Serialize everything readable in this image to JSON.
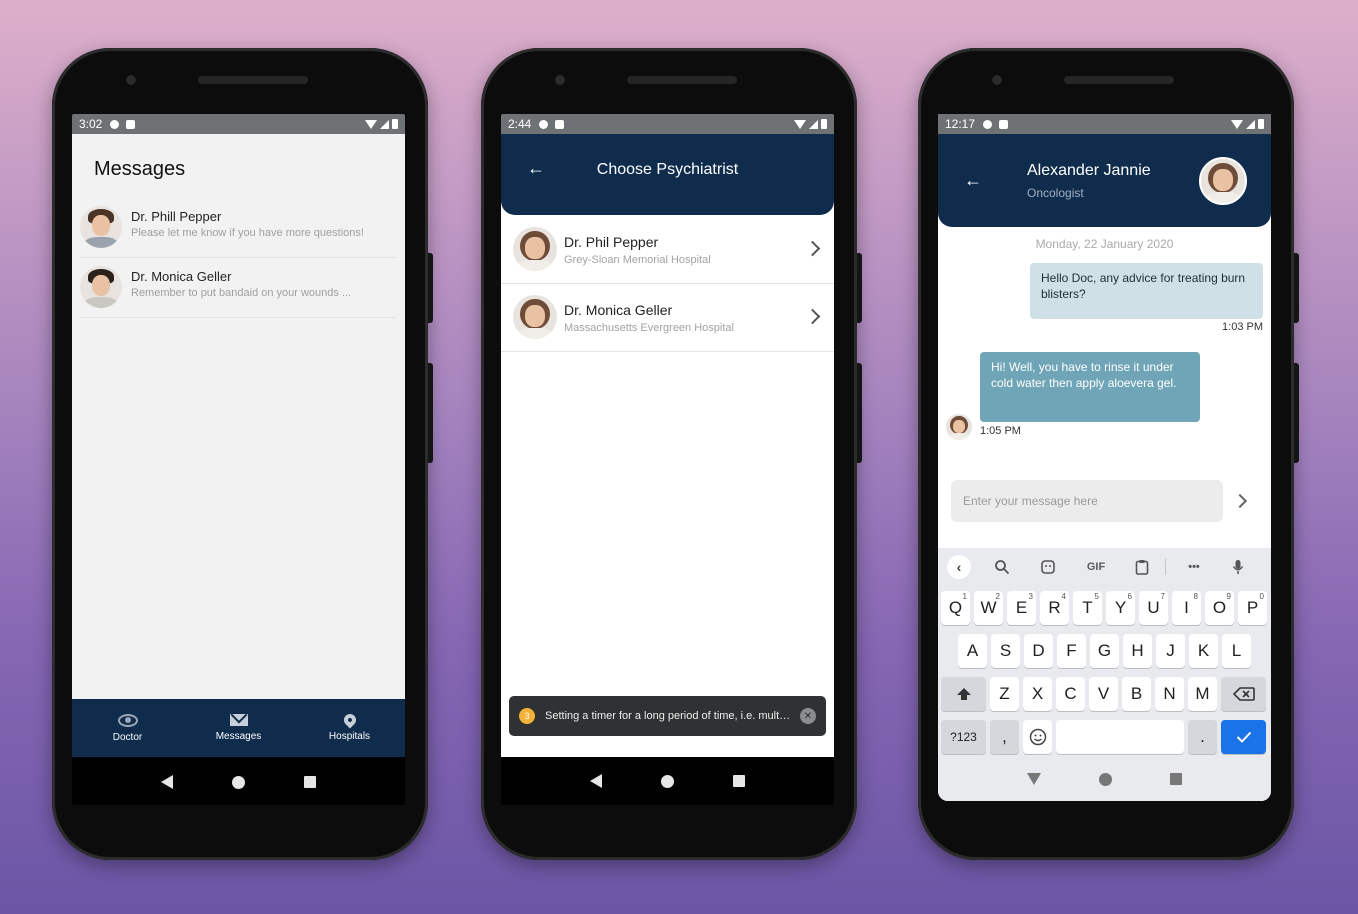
{
  "phone1": {
    "status": {
      "time": "3:02"
    },
    "title": "Messages",
    "messages": [
      {
        "name": "Dr. Phill Pepper",
        "preview": "Please let me know if you have more questions!"
      },
      {
        "name": "Dr. Monica Geller",
        "preview": "Remember to put bandaid on your wounds ..."
      }
    ],
    "bottom_nav": [
      {
        "label": "Doctor",
        "icon": "eye-icon"
      },
      {
        "label": "Messages",
        "icon": "mail-icon"
      },
      {
        "label": "Hospitals",
        "icon": "location-pin-icon"
      }
    ]
  },
  "phone2": {
    "status": {
      "time": "2:44"
    },
    "title": "Choose Psychiatrist",
    "doctors": [
      {
        "name": "Dr. Phil Pepper",
        "hospital": "Grey-Sloan Memorial Hospital"
      },
      {
        "name": "Dr. Monica Geller",
        "hospital": "Massachusetts Evergreen Hospital"
      }
    ],
    "toast": {
      "badge": "3",
      "text": "Setting a timer for a long period of time, i.e. multiple minutes, is a performance and correctness issue",
      "close": "✕"
    }
  },
  "phone3": {
    "status": {
      "time": "12:17"
    },
    "contact_name": "Alexander Jannie",
    "contact_role": "Oncologist",
    "date": "Monday, 22 January 2020",
    "messages": [
      {
        "direction": "out",
        "text": "Hello Doc, any advice for treating burn blisters?",
        "time": "1:03 PM"
      },
      {
        "direction": "in",
        "text": "Hi! Well, you have to rinse it under cold water then apply aloevera gel.",
        "time": "1:05 PM"
      }
    ],
    "input_placeholder": "Enter your message here",
    "keyboard": {
      "toolbar": [
        "‹",
        "GIF",
        "•••"
      ],
      "row1": [
        "Q",
        "W",
        "E",
        "R",
        "T",
        "Y",
        "U",
        "I",
        "O",
        "P"
      ],
      "row1_sup": [
        "1",
        "2",
        "3",
        "4",
        "5",
        "6",
        "7",
        "8",
        "9",
        "0"
      ],
      "row2": [
        "A",
        "S",
        "D",
        "F",
        "G",
        "H",
        "J",
        "K",
        "L"
      ],
      "row3": [
        "Z",
        "X",
        "C",
        "V",
        "B",
        "N",
        "M"
      ],
      "symbols": "?123",
      "comma": ",",
      "period": "."
    }
  }
}
